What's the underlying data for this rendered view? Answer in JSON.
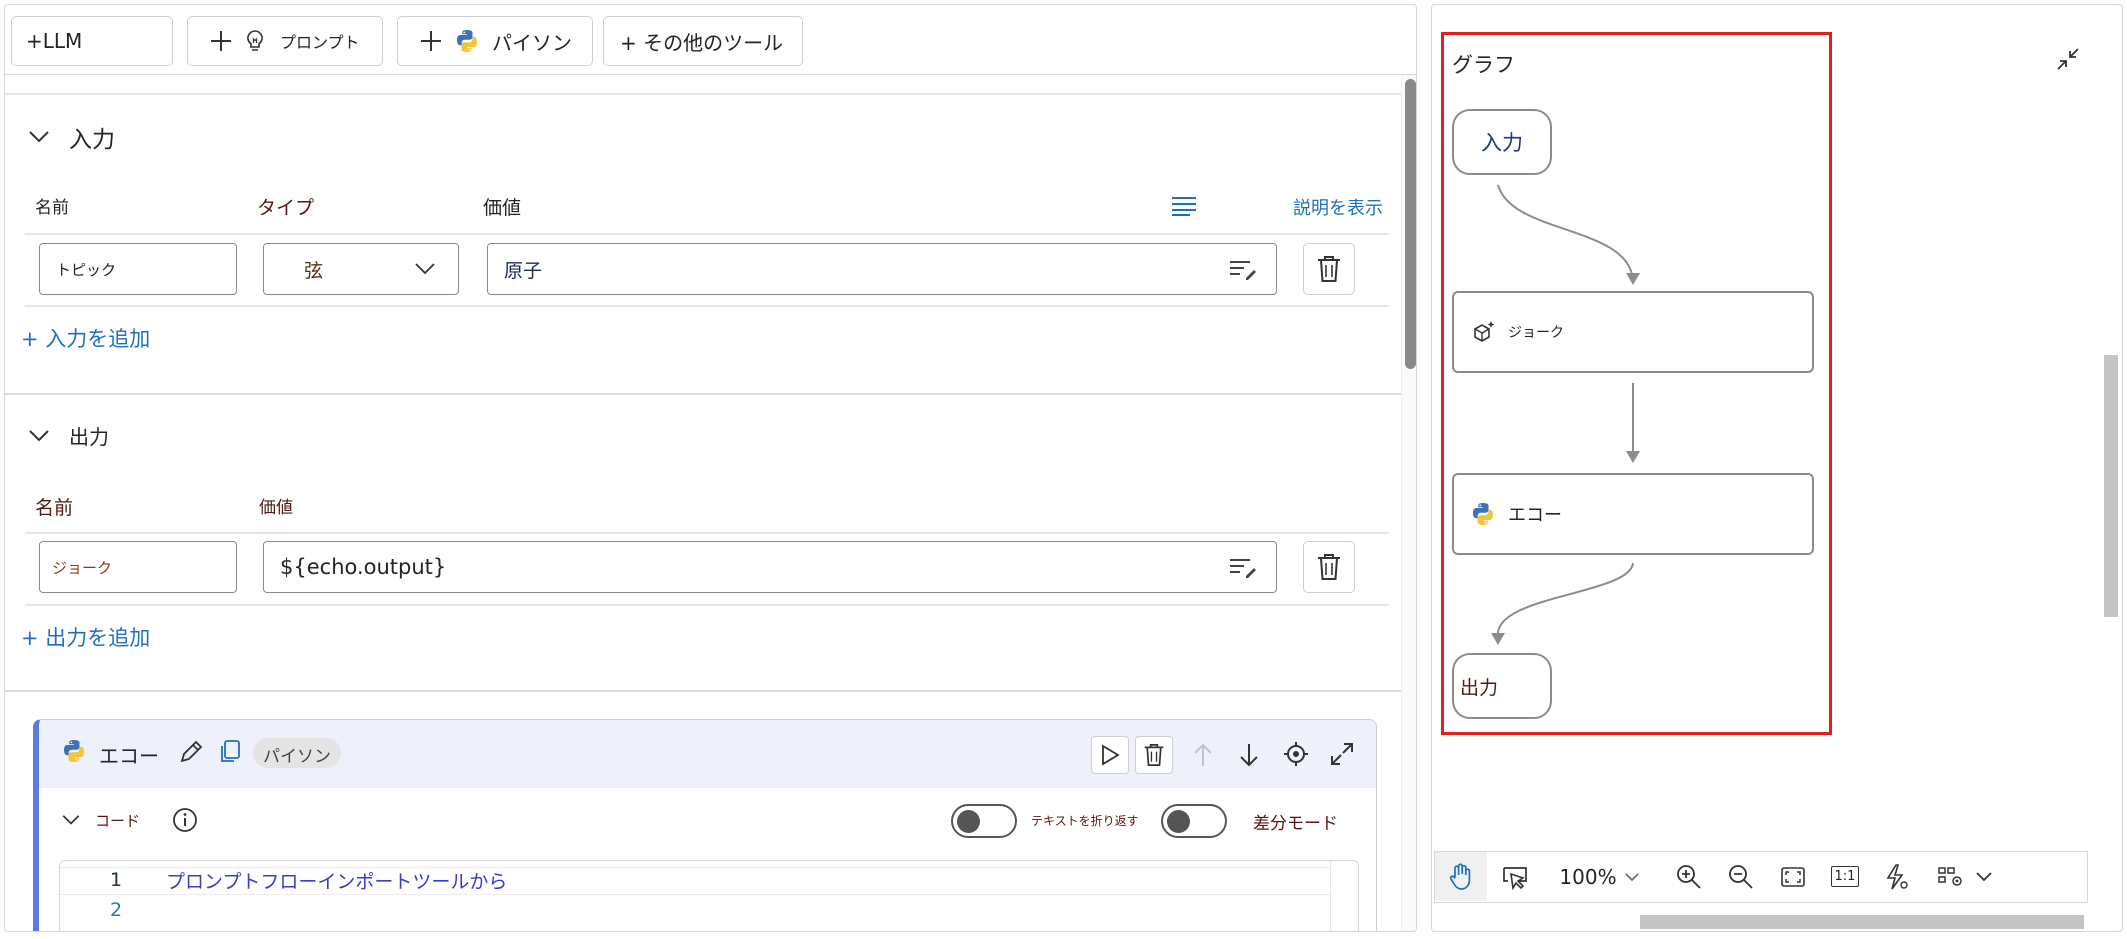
{
  "toolbar": {
    "llm_label": "+LLM",
    "prompt_label": "プロンプト",
    "python_label": "パイソン",
    "more_tools_label": "+ その他のツール"
  },
  "inputs": {
    "section_title": "入力",
    "col_name": "名前",
    "col_type": "タイプ",
    "col_value": "価値",
    "show_description": "説明を表示",
    "row": {
      "name": "トピック",
      "type": "弦",
      "value": "原子"
    },
    "add_label": "+ 入力を追加"
  },
  "outputs": {
    "section_title": "出力",
    "col_name": "名前",
    "col_value": "価値",
    "row": {
      "name": "ジョーク",
      "value": "${echo.output}"
    },
    "add_label": "+ 出力を追加"
  },
  "node_card": {
    "title": "エコー",
    "badge": "パイソン",
    "code_label": "コード",
    "wrap_text_label": "テキストを折り返す",
    "diff_mode_label": "差分モード",
    "code_lines": [
      {
        "num": "1",
        "text": "プロンプトフローインポートツールから"
      },
      {
        "num": "2",
        "text": ""
      }
    ]
  },
  "graph": {
    "title": "グラフ",
    "nodes": {
      "input": "入力",
      "joke": "ジョーク",
      "echo": "エコー",
      "output": "出力"
    },
    "highlight_color": "#e01f1f"
  },
  "graph_toolbar": {
    "zoom": "100%",
    "one_to_one": "1:1"
  },
  "colors": {
    "accent": "#1f6fbf",
    "card_accent": "#5b7be0",
    "card_header_bg": "#eef0fb"
  }
}
